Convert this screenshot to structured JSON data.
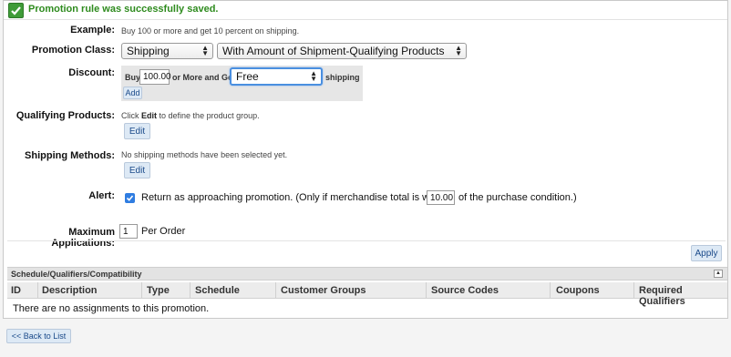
{
  "success_message": "Promotion rule was successfully saved.",
  "example": {
    "label": "Example:",
    "text": "Buy 100 or more and get 10 percent on shipping."
  },
  "promotion_class": {
    "label": "Promotion Class:",
    "class_value": "Shipping",
    "type_value": "With Amount of Shipment-Qualifying Products"
  },
  "discount": {
    "label": "Discount:",
    "buy_text": "Buy",
    "amount_value": "100.00",
    "or_more_text": "or More and Get",
    "reward_value": "Free",
    "shipping_text": "shipping",
    "add_label": "Add"
  },
  "qualifying_products": {
    "label": "Qualifying Products:",
    "hint_pre": "Click",
    "hint_bold": "Edit",
    "hint_post": "to define the product group.",
    "edit_label": "Edit"
  },
  "shipping_methods": {
    "label": "Shipping Methods:",
    "hint": "No shipping methods have been selected yet.",
    "edit_label": "Edit"
  },
  "alert": {
    "label": "Alert:",
    "checked": true,
    "text_pre": "Return as approaching promotion. (Only if merchandise total is within",
    "threshold_value": "10.00",
    "text_post": "of the purchase condition.)"
  },
  "max_applications": {
    "label": "Maximum Applications:",
    "value": "1",
    "suffix": "Per Order"
  },
  "apply_label": "Apply",
  "schedule_section": {
    "title": "Schedule/Qualifiers/Compatibility",
    "columns": [
      "ID",
      "Description",
      "Type",
      "Schedule",
      "Customer Groups",
      "Source Codes",
      "Coupons",
      "Required Qualifiers"
    ],
    "empty_text": "There are no assignments to this promotion."
  },
  "back_label": "<< Back to List",
  "colors": {
    "success_green": "#2e8b1e",
    "button_bg": "#dde9f5",
    "link_blue": "#1a4a8a",
    "checkbox_blue": "#2f7de1"
  }
}
